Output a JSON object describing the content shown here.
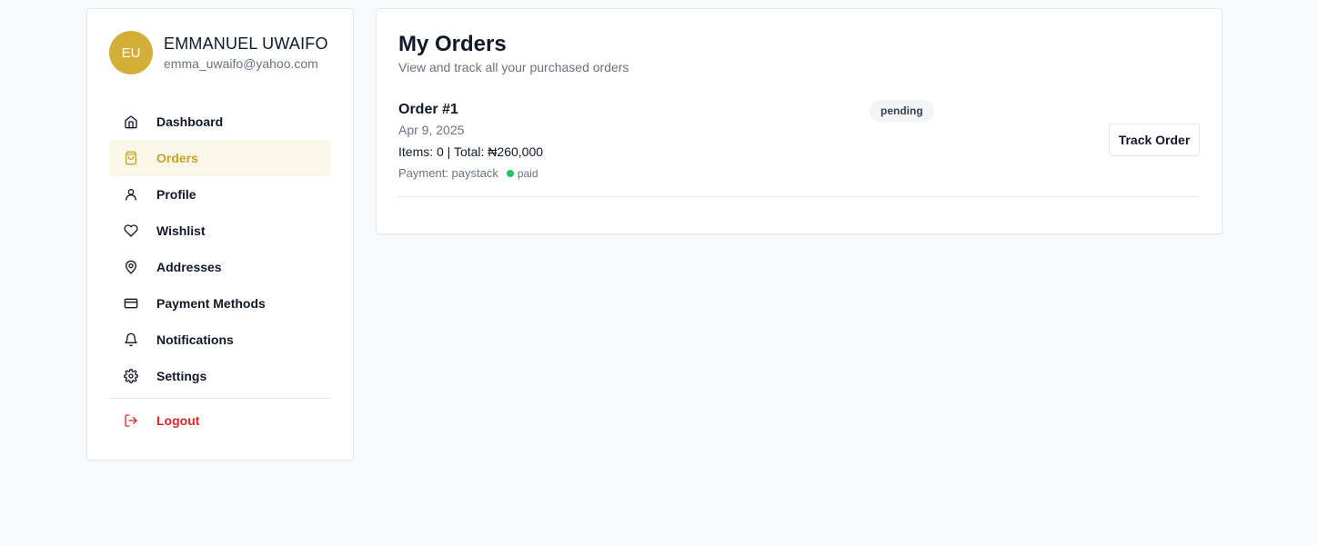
{
  "user": {
    "initials": "EU",
    "name": "EMMANUEL UWAIFO",
    "email": "emma_uwaifo@yahoo.com"
  },
  "sidebar": {
    "items": [
      {
        "label": "Dashboard",
        "icon": "home-icon"
      },
      {
        "label": "Orders",
        "icon": "shopping-bag-icon",
        "active": true
      },
      {
        "label": "Profile",
        "icon": "user-icon"
      },
      {
        "label": "Wishlist",
        "icon": "heart-icon"
      },
      {
        "label": "Addresses",
        "icon": "map-pin-icon"
      },
      {
        "label": "Payment Methods",
        "icon": "credit-card-icon"
      },
      {
        "label": "Notifications",
        "icon": "bell-icon"
      },
      {
        "label": "Settings",
        "icon": "gear-icon"
      }
    ],
    "logout": {
      "label": "Logout",
      "icon": "logout-icon"
    }
  },
  "main": {
    "title": "My Orders",
    "subtitle": "View and track all your purchased orders",
    "orders": [
      {
        "title": "Order #1",
        "date": "Apr 9, 2025",
        "summary": "Items: 0 | Total: ₦260,000",
        "payment": "Payment: paystack",
        "payment_status": "paid",
        "status": "pending",
        "action_label": "Track Order"
      }
    ]
  },
  "colors": {
    "accent": "#d4af37",
    "active_bg": "#fbf7e8",
    "logout": "#dc2626",
    "paid": "#22c55e"
  }
}
